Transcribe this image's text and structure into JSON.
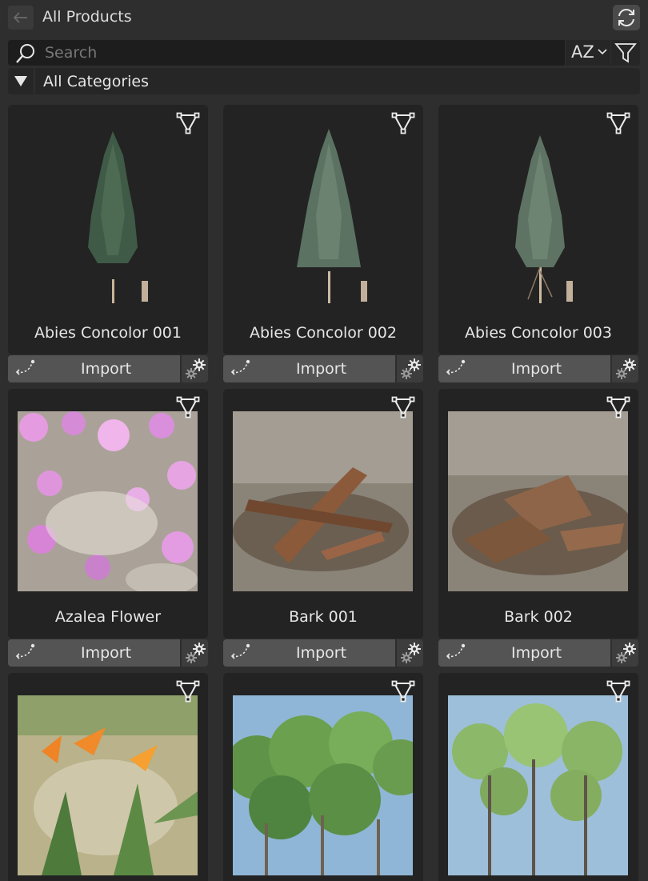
{
  "header": {
    "title": "All Products"
  },
  "search": {
    "placeholder": "Search",
    "value": ""
  },
  "sort": {
    "label": "AZ"
  },
  "category": {
    "label": "All Categories"
  },
  "import_label": "Import",
  "colors": {
    "background": "#2e2e2e",
    "card": "#232323",
    "import_button": "#545454"
  },
  "products": [
    {
      "name": "Abies Concolor 001",
      "thumbnail": "tree-pine-1"
    },
    {
      "name": "Abies Concolor 002",
      "thumbnail": "tree-pine-2"
    },
    {
      "name": "Abies Concolor 003",
      "thumbnail": "tree-pine-3"
    },
    {
      "name": "Azalea Flower",
      "thumbnail": "azalea-photo"
    },
    {
      "name": "Bark 001",
      "thumbnail": "bark-photo-1"
    },
    {
      "name": "Bark 002",
      "thumbnail": "bark-photo-2"
    },
    {
      "name": "",
      "thumbnail": "bird-of-paradise-photo"
    },
    {
      "name": "",
      "thumbnail": "forest-photo-1"
    },
    {
      "name": "",
      "thumbnail": "forest-photo-2"
    }
  ]
}
